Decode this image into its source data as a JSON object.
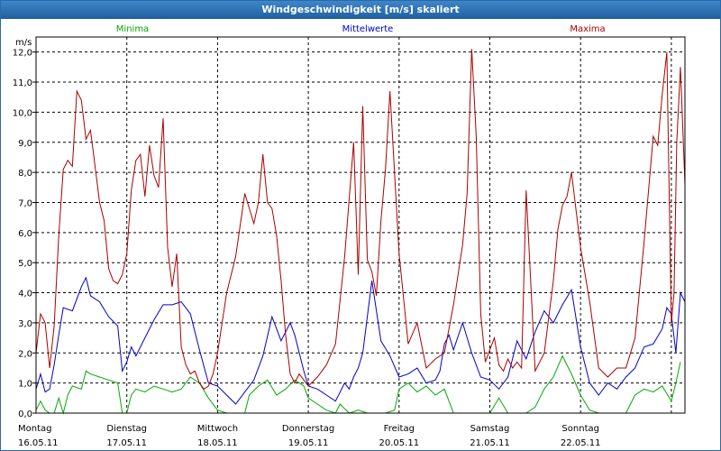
{
  "window": {
    "title": "Windgeschwindigkeit [m/s] skaliert"
  },
  "colors": {
    "minima": "#00aa00",
    "mittelwerte": "#0000cc",
    "maxima": "#aa0000",
    "grid": "#000000"
  },
  "chart_data": {
    "type": "line",
    "title": "",
    "ylabel": "m/s",
    "ylim": [
      0,
      12.5
    ],
    "yticks": [
      0,
      1,
      2,
      3,
      4,
      5,
      6,
      7,
      8,
      9,
      10,
      11,
      12
    ],
    "ytick_labels": [
      "0,0",
      "1,0",
      "2,0",
      "3,0",
      "4,0",
      "5,0",
      "6,0",
      "7,0",
      "8,0",
      "9,0",
      "10,0",
      "11,0",
      "12,0"
    ],
    "xlim": [
      0,
      7.15
    ],
    "x_day_labels": [
      {
        "day": "Montag",
        "date": "16.05.11"
      },
      {
        "day": "Dienstag",
        "date": "17.05.11"
      },
      {
        "day": "Mittwoch",
        "date": "18.05.11"
      },
      {
        "day": "Donnerstag",
        "date": "19.05.11"
      },
      {
        "day": "Freitag",
        "date": "20.05.11"
      },
      {
        "day": "Samstag",
        "date": "21.05.11"
      },
      {
        "day": "Sonntag",
        "date": "22.05.11"
      }
    ],
    "x_gridlines": [
      1,
      2,
      3,
      4,
      5,
      6,
      7
    ],
    "legend": [
      "Minima",
      "Mittelwerte",
      "Maxima"
    ],
    "series": [
      {
        "name": "Minima",
        "x": [
          0,
          0.05,
          0.1,
          0.15,
          0.2,
          0.25,
          0.3,
          0.35,
          0.4,
          0.5,
          0.55,
          0.6,
          0.7,
          0.8,
          0.9,
          0.95,
          1.0,
          1.05,
          1.1,
          1.2,
          1.3,
          1.4,
          1.5,
          1.6,
          1.7,
          1.8,
          1.9,
          2.0,
          2.1,
          2.2,
          2.3,
          2.35,
          2.45,
          2.55,
          2.65,
          2.75,
          2.85,
          2.95,
          3.0,
          3.1,
          3.2,
          3.3,
          3.35,
          3.45,
          3.55,
          3.65,
          3.75,
          3.85,
          3.95,
          4.0,
          4.1,
          4.2,
          4.3,
          4.4,
          4.5,
          4.6,
          4.7,
          4.8,
          4.9,
          5.0,
          5.1,
          5.2,
          5.3,
          5.4,
          5.5,
          5.6,
          5.7,
          5.8,
          5.9,
          6.0,
          6.1,
          6.2,
          6.3,
          6.4,
          6.5,
          6.6,
          6.7,
          6.8,
          6.9,
          7.0,
          7.05,
          7.1
        ],
        "values": [
          0.1,
          0.4,
          0.1,
          0.0,
          0.0,
          0.5,
          0.0,
          0.6,
          0.9,
          0.8,
          1.4,
          1.3,
          1.2,
          1.1,
          1.0,
          0.0,
          0.0,
          0.6,
          0.8,
          0.7,
          0.9,
          0.8,
          0.7,
          0.8,
          1.2,
          1.0,
          0.5,
          0.1,
          0.0,
          0.0,
          0.0,
          0.6,
          0.9,
          1.1,
          0.6,
          0.8,
          1.1,
          0.9,
          0.5,
          0.3,
          0.1,
          0.0,
          0.3,
          0.0,
          0.1,
          0.0,
          0.0,
          0.0,
          0.1,
          0.8,
          1.0,
          0.7,
          0.9,
          0.6,
          0.8,
          0.0,
          0.0,
          0.0,
          0.0,
          0.0,
          0.5,
          0.0,
          0.0,
          0.0,
          0.2,
          0.8,
          1.2,
          1.9,
          1.3,
          0.6,
          0.1,
          0.0,
          0.0,
          0.0,
          0.0,
          0.6,
          0.8,
          0.7,
          0.9,
          0.4,
          1.0,
          1.7
        ]
      },
      {
        "name": "Mittelwerte",
        "x": [
          0,
          0.05,
          0.1,
          0.15,
          0.2,
          0.25,
          0.3,
          0.4,
          0.5,
          0.55,
          0.6,
          0.7,
          0.8,
          0.9,
          0.95,
          1.0,
          1.05,
          1.1,
          1.2,
          1.3,
          1.4,
          1.5,
          1.6,
          1.7,
          1.8,
          1.9,
          2.0,
          2.1,
          2.2,
          2.3,
          2.4,
          2.5,
          2.6,
          2.65,
          2.7,
          2.8,
          2.85,
          2.95,
          3.0,
          3.1,
          3.2,
          3.3,
          3.4,
          3.45,
          3.5,
          3.55,
          3.6,
          3.7,
          3.8,
          3.9,
          4.0,
          4.1,
          4.2,
          4.3,
          4.4,
          4.45,
          4.5,
          4.55,
          4.6,
          4.7,
          4.8,
          4.9,
          5.0,
          5.1,
          5.2,
          5.3,
          5.4,
          5.5,
          5.6,
          5.7,
          5.8,
          5.9,
          6.0,
          6.1,
          6.2,
          6.3,
          6.4,
          6.5,
          6.6,
          6.7,
          6.8,
          6.9,
          6.95,
          7.0,
          7.05,
          7.1,
          7.15
        ],
        "values": [
          0.8,
          1.3,
          0.7,
          0.8,
          1.6,
          2.6,
          3.5,
          3.4,
          4.2,
          4.5,
          3.9,
          3.7,
          3.2,
          2.9,
          1.4,
          1.7,
          2.2,
          1.9,
          2.5,
          3.1,
          3.6,
          3.6,
          3.7,
          3.3,
          2.1,
          1.0,
          0.9,
          0.6,
          0.3,
          0.7,
          1.1,
          1.9,
          3.2,
          2.8,
          2.4,
          3.0,
          2.6,
          1.4,
          0.9,
          0.8,
          0.6,
          0.4,
          1.0,
          0.8,
          1.2,
          1.5,
          2.0,
          4.4,
          2.4,
          1.9,
          1.2,
          1.3,
          1.5,
          1.0,
          1.1,
          1.4,
          2.3,
          2.6,
          2.1,
          3.0,
          2.0,
          1.2,
          1.1,
          0.8,
          1.2,
          2.4,
          1.8,
          2.7,
          3.4,
          3.0,
          3.6,
          4.1,
          2.2,
          1.0,
          0.6,
          1.0,
          0.8,
          1.2,
          1.5,
          2.2,
          2.3,
          2.8,
          3.5,
          3.3,
          2.0,
          4.0,
          3.7
        ]
      },
      {
        "name": "Maxima",
        "x": [
          0,
          0.05,
          0.1,
          0.15,
          0.2,
          0.25,
          0.3,
          0.35,
          0.4,
          0.45,
          0.5,
          0.55,
          0.6,
          0.65,
          0.7,
          0.75,
          0.8,
          0.85,
          0.9,
          0.95,
          1.0,
          1.05,
          1.1,
          1.15,
          1.2,
          1.25,
          1.3,
          1.35,
          1.4,
          1.45,
          1.5,
          1.55,
          1.6,
          1.65,
          1.7,
          1.75,
          1.8,
          1.85,
          1.9,
          1.95,
          2.0,
          2.1,
          2.2,
          2.3,
          2.4,
          2.45,
          2.5,
          2.55,
          2.6,
          2.65,
          2.7,
          2.75,
          2.8,
          2.85,
          2.9,
          2.95,
          3.0,
          3.1,
          3.2,
          3.3,
          3.4,
          3.5,
          3.55,
          3.6,
          3.65,
          3.7,
          3.75,
          3.8,
          3.85,
          3.9,
          4.0,
          4.1,
          4.2,
          4.3,
          4.4,
          4.5,
          4.6,
          4.7,
          4.75,
          4.8,
          4.85,
          4.9,
          4.95,
          5.0,
          5.05,
          5.1,
          5.15,
          5.2,
          5.25,
          5.3,
          5.35,
          5.4,
          5.5,
          5.6,
          5.7,
          5.75,
          5.8,
          5.85,
          5.9,
          6.0,
          6.1,
          6.2,
          6.3,
          6.4,
          6.5,
          6.6,
          6.7,
          6.8,
          6.85,
          6.9,
          6.95,
          7.0,
          7.03,
          7.06,
          7.1,
          7.15
        ],
        "values": [
          2.0,
          3.3,
          3.0,
          1.5,
          2.9,
          5.9,
          8.1,
          8.4,
          8.2,
          10.7,
          10.4,
          9.1,
          9.4,
          8.2,
          7.0,
          6.4,
          4.8,
          4.4,
          4.3,
          4.6,
          5.3,
          7.4,
          8.4,
          8.6,
          7.2,
          8.9,
          7.9,
          7.5,
          9.8,
          5.5,
          4.2,
          5.3,
          2.2,
          1.6,
          1.3,
          1.4,
          1.0,
          0.8,
          0.9,
          1.3,
          2.0,
          4.0,
          5.2,
          7.3,
          6.3,
          7.0,
          8.6,
          7.0,
          6.8,
          5.9,
          4.4,
          2.6,
          1.3,
          1.0,
          1.3,
          1.1,
          0.9,
          1.2,
          1.6,
          2.3,
          5.2,
          9.0,
          4.6,
          10.2,
          5.1,
          4.7,
          3.9,
          6.4,
          8.1,
          10.7,
          5.3,
          2.3,
          3.0,
          1.5,
          1.8,
          2.0,
          3.6,
          5.6,
          7.3,
          12.1,
          9.2,
          3.3,
          1.7,
          2.1,
          2.5,
          1.6,
          1.4,
          1.8,
          1.5,
          1.7,
          1.5,
          7.4,
          1.4,
          2.0,
          4.4,
          6.1,
          6.9,
          7.2,
          8.0,
          5.5,
          3.7,
          1.5,
          1.2,
          1.5,
          1.5,
          2.5,
          5.7,
          9.2,
          8.9,
          10.6,
          12.0,
          3.0,
          4.0,
          9.0,
          11.5,
          7.6
        ]
      }
    ]
  }
}
